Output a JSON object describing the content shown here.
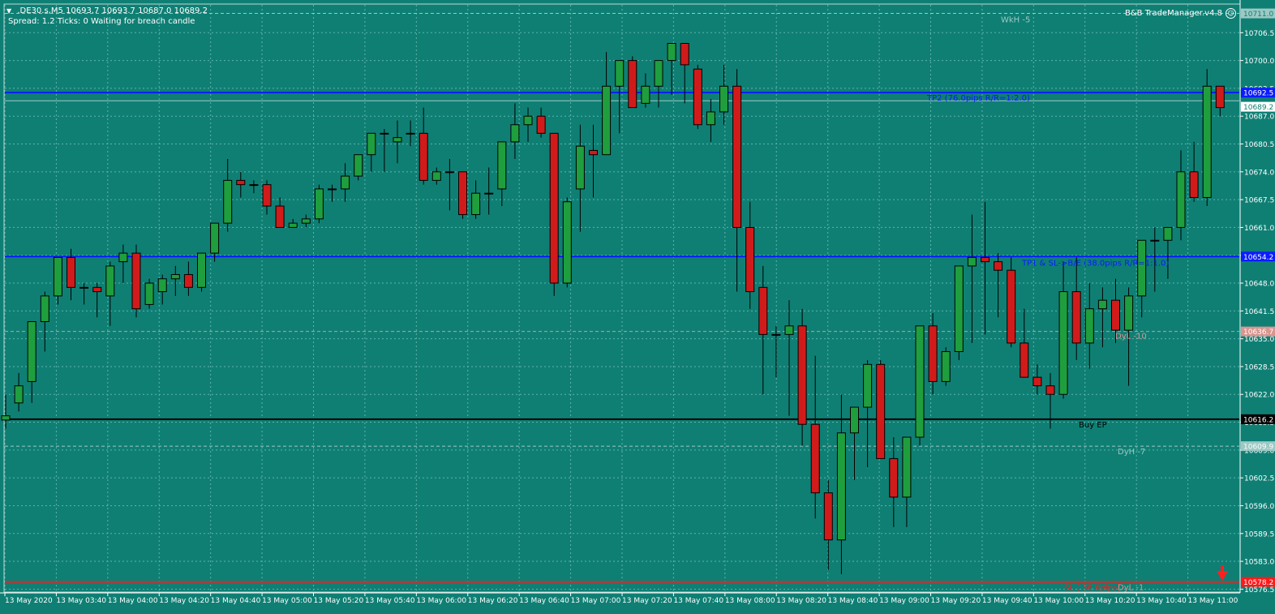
{
  "header": {
    "symbol_line": ".DE30.s,M5  10693.7 10693.7 10687.0 10689.2",
    "status_line": "Spread: 1.2  Ticks: 0  Waiting for breach candle",
    "indicator_name": "B&B TradeManager.v4.8"
  },
  "colors": {
    "background": "#0f7f74",
    "grid": "#5fb3aa",
    "bull": "#1f9e3e",
    "bear": "#d11b1b",
    "wick": "#000000",
    "blue_line": "#0a1cff",
    "buy_line": "#000000",
    "sl_line": "#ff1a1a",
    "dyl10_line": "#d9958f"
  },
  "chart_data": {
    "type": "candlestick",
    "symbol": ".DE30.s",
    "timeframe": "M5",
    "ylim": [
      10576,
      10713
    ],
    "y_ticks": [
      "10706.5",
      "10700.0",
      "10693.5",
      "10687.0",
      "10680.5",
      "10674.0",
      "10667.5",
      "10661.0",
      "10654.5",
      "10648.0",
      "10641.5",
      "10635.0",
      "10628.5",
      "10622.0",
      "10615.5",
      "10609.0",
      "10602.5",
      "10596.0",
      "10589.5",
      "10583.0",
      "10576.5"
    ],
    "x_tick_labels": [
      "13 May 2020",
      "13 May 03:40",
      "13 May 04:00",
      "13 May 04:20",
      "13 May 04:40",
      "13 May 05:00",
      "13 May 05:20",
      "13 May 05:40",
      "13 May 06:00",
      "13 May 06:20",
      "13 May 06:40",
      "13 May 07:00",
      "13 May 07:20",
      "13 May 07:40",
      "13 May 08:00",
      "13 May 08:20",
      "13 May 08:40",
      "13 May 09:00",
      "13 May 09:20",
      "13 May 09:40",
      "13 May 10:00",
      "13 May 10:20",
      "13 May 10:40",
      "13 May 11:00"
    ],
    "ohlc": [
      [
        10616,
        10622,
        10614,
        10617
      ],
      [
        10620,
        10627,
        10618,
        10624
      ],
      [
        10625,
        10638,
        10620,
        10639
      ],
      [
        10639,
        10646,
        10632,
        10645
      ],
      [
        10645,
        10653,
        10643,
        10654
      ],
      [
        10654,
        10656,
        10644,
        10647
      ],
      [
        10647,
        10648,
        10643,
        10647
      ],
      [
        10647,
        10648,
        10640,
        10646
      ],
      [
        10645,
        10653,
        10638,
        10652
      ],
      [
        10653,
        10657,
        10648,
        10655
      ],
      [
        10655,
        10657,
        10640,
        10642
      ],
      [
        10643,
        10649,
        10642,
        10648
      ],
      [
        10646,
        10650,
        10643,
        10649
      ],
      [
        10649,
        10652,
        10645,
        10650
      ],
      [
        10650,
        10653,
        10645,
        10647
      ],
      [
        10647,
        10655,
        10646,
        10655
      ],
      [
        10655,
        10660,
        10653,
        10662
      ],
      [
        10662,
        10677,
        10660,
        10672
      ],
      [
        10672,
        10674,
        10668,
        10671
      ],
      [
        10671,
        10672,
        10669,
        10671
      ],
      [
        10671,
        10672,
        10664,
        10666
      ],
      [
        10666,
        10668,
        10661,
        10661
      ],
      [
        10661,
        10663,
        10661,
        10662
      ],
      [
        10662,
        10664,
        10661,
        10663
      ],
      [
        10663,
        10671,
        10662,
        10670
      ],
      [
        10670,
        10671,
        10667,
        10670
      ],
      [
        10670,
        10676,
        10667,
        10673
      ],
      [
        10673,
        10678,
        10672,
        10678
      ],
      [
        10678,
        10681,
        10674,
        10683
      ],
      [
        10683,
        10684,
        10674,
        10683
      ],
      [
        10681,
        10686,
        10676,
        10682
      ],
      [
        10683,
        10686,
        10680,
        10683
      ],
      [
        10683,
        10689,
        10671,
        10672
      ],
      [
        10672,
        10675,
        10671,
        10674
      ],
      [
        10674,
        10677,
        10665,
        10674
      ],
      [
        10674,
        10674,
        10663,
        10664
      ],
      [
        10664,
        10672,
        10663,
        10669
      ],
      [
        10669,
        10675,
        10664,
        10669
      ],
      [
        10670,
        10677,
        10666,
        10681
      ],
      [
        10681,
        10690,
        10677,
        10685
      ],
      [
        10685,
        10689,
        10681,
        10687
      ],
      [
        10687,
        10689,
        10682,
        10683
      ],
      [
        10683,
        10683,
        10645,
        10648
      ],
      [
        10648,
        10668,
        10647,
        10667
      ],
      [
        10670,
        10685,
        10660,
        10680
      ],
      [
        10679,
        10685,
        10668,
        10678
      ],
      [
        10678,
        10702,
        10678,
        10694
      ],
      [
        10694,
        10699,
        10683,
        10700
      ],
      [
        10700,
        10701,
        10689,
        10689
      ],
      [
        10690,
        10697,
        10689,
        10694
      ],
      [
        10694,
        10700,
        10689,
        10700
      ],
      [
        10700,
        10704,
        10692,
        10704
      ],
      [
        10704,
        10703,
        10690,
        10699
      ],
      [
        10698,
        10699,
        10684,
        10685
      ],
      [
        10685,
        10691,
        10681,
        10688
      ],
      [
        10688,
        10699,
        10685,
        10694
      ],
      [
        10694,
        10698,
        10646,
        10661
      ],
      [
        10661,
        10667,
        10642,
        10646
      ],
      [
        10647,
        10652,
        10622,
        10636
      ],
      [
        10636,
        10638,
        10626,
        10636
      ],
      [
        10636,
        10644,
        10617,
        10638
      ],
      [
        10638,
        10642,
        10610,
        10615
      ],
      [
        10615,
        10631,
        10593,
        10599
      ],
      [
        10599,
        10602,
        10581,
        10588
      ],
      [
        10588,
        10622,
        10580,
        10613
      ],
      [
        10613,
        10615,
        10602,
        10619
      ],
      [
        10619,
        10630,
        10605,
        10629
      ],
      [
        10629,
        10630,
        10609,
        10607
      ],
      [
        10607,
        10612,
        10591,
        10598
      ],
      [
        10598,
        10611,
        10591,
        10612
      ],
      [
        10612,
        10638,
        10610,
        10638
      ],
      [
        10638,
        10641,
        10622,
        10625
      ],
      [
        10625,
        10633,
        10624,
        10632
      ],
      [
        10632,
        10649,
        10630,
        10652
      ],
      [
        10652,
        10664,
        10634,
        10654
      ],
      [
        10654,
        10667,
        10636,
        10653
      ],
      [
        10653,
        10655,
        10640,
        10651
      ],
      [
        10651,
        10654,
        10633,
        10634
      ],
      [
        10634,
        10642,
        10629,
        10626
      ],
      [
        10626,
        10629,
        10622,
        10624
      ],
      [
        10624,
        10627,
        10614,
        10622
      ],
      [
        10622,
        10653,
        10621,
        10646
      ],
      [
        10646,
        10654,
        10630,
        10634
      ],
      [
        10634,
        10648,
        10628,
        10642
      ],
      [
        10642,
        10647,
        10633,
        10644
      ],
      [
        10644,
        10649,
        10634,
        10637
      ],
      [
        10637,
        10647,
        10624,
        10645
      ],
      [
        10645,
        10658,
        10640,
        10658
      ],
      [
        10658,
        10661,
        10646,
        10658
      ],
      [
        10658,
        10660,
        10649,
        10661
      ],
      [
        10661,
        10679,
        10658,
        10674
      ],
      [
        10674,
        10681,
        10667,
        10668
      ],
      [
        10668,
        10698,
        10666,
        10694
      ],
      [
        10694,
        10694,
        10687,
        10689
      ]
    ],
    "levels": [
      {
        "price": 10692.5,
        "tag": "10692.5",
        "label": "TP2 (76.0pips R/R=1:2.0)"
      },
      {
        "price": 10654.2,
        "tag": "10654.2",
        "label": "TP1 & SL->B/E (38.0pips R/R=1:1.0)"
      },
      {
        "price": 10616.2,
        "tag": "10616.2",
        "label": "Buy EP"
      },
      {
        "price": 10578.2,
        "tag": "10578.2",
        "label": "SL ( 38.0pips)"
      },
      {
        "price": 10636.7,
        "tag": "10636.7",
        "label": "DyL -10"
      },
      {
        "price": 10609.9,
        "tag": "10609.9",
        "label": "DyH -7"
      },
      {
        "price": 10711.0,
        "tag": "10711.0",
        "label": "WkH -5"
      }
    ],
    "current_price": {
      "tag": "10689.2"
    },
    "extra_labels": [
      "DyL -1"
    ]
  }
}
